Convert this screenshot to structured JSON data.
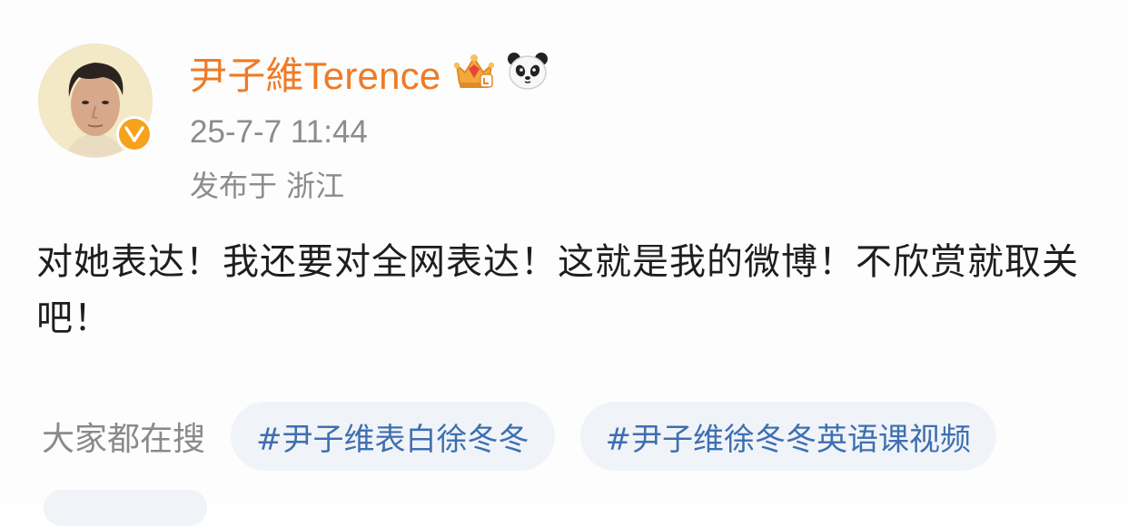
{
  "post": {
    "author": {
      "name": "尹子維Terence",
      "avatar_icon": "profile-photo",
      "verified_icon": "verified-v-badge",
      "badges": [
        "crown-member-icon",
        "panda-emoji-icon"
      ]
    },
    "timestamp": "25-7-7 11:44",
    "location": "发布于 浙江",
    "content": "对她表达！我还要对全网表达！这就是我的微博！不欣赏就取关吧！",
    "trending": {
      "label": "大家都在搜",
      "topics": [
        "#尹子维表白徐冬冬",
        "#尹子维徐冬冬英语课视频"
      ]
    }
  },
  "colors": {
    "username": "#f07a25",
    "meta": "#8c8c8c",
    "topic_text": "#3f6fb0",
    "topic_bg": "#f0f4f9",
    "verified": "#f7a21b"
  }
}
